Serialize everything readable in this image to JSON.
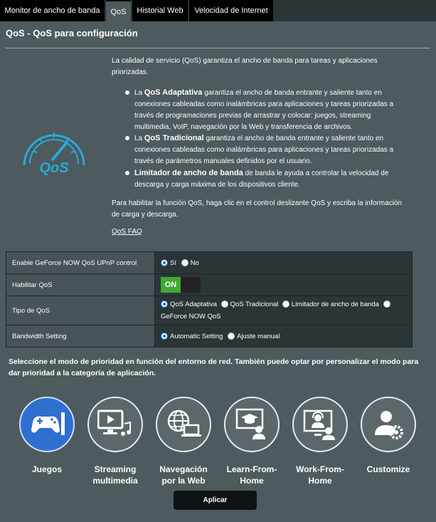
{
  "tabs": [
    {
      "label": "Monitor de ancho de banda"
    },
    {
      "label": "QoS"
    },
    {
      "label": "Historial Web"
    },
    {
      "label": "Velocidad de Internet"
    }
  ],
  "page_title": "QoS - QoS para configuración",
  "intro": "La calidad de servicio (QoS) garantiza el ancho de banda para tareas y aplicaciones priorizadas.",
  "bullets": [
    {
      "bold": "QoS Adaptativa",
      "pre": "La ",
      "lines": [
        "garantiza el ancho de banda entrante y saliente tanto en",
        "conexiones cableadas como inalámbricas para aplicaciones y tareas priorizadas a",
        "través de programaciones previas de arrastrar y colocar: juegos, streaming",
        "multimedia, VoIP, navegación por la Web y transferencia de archivos."
      ]
    },
    {
      "bold": "QoS Tradicional",
      "pre": "La ",
      "lines": [
        "garantiza el ancho de banda entrante y saliente tanto en",
        "conexiones cableadas como inalámbricas para aplicaciones y tareas priorizadas a",
        "través de parámetros manuales definidos por el usuario."
      ]
    },
    {
      "bold": "Limitador de ancho de banda",
      "pre": "",
      "lines": [
        "de banda le ayuda a controlar la velocidad de",
        "descarga y carga máxima de los dispositivos cliente."
      ]
    }
  ],
  "enable_hint_lines": [
    "Para habilitar la función QoS, haga clic en el control deslizante QoS y escriba la información",
    "de carga y descarga."
  ],
  "faq_label": "QoS FAQ",
  "logo_text": "QoS",
  "settings": {
    "geforce": {
      "label": "Enable GeForce NOW QoS UPnP control",
      "options": [
        "Sí",
        "No"
      ],
      "selected": "Sí"
    },
    "enable_qos": {
      "label": "Habilitar QoS",
      "toggle_text": "ON"
    },
    "qos_type": {
      "label": "Tipo de QoS",
      "options": [
        "QoS Adaptativa",
        "QoS Tradicional",
        "Limitador de ancho de banda",
        "GeForce NOW QoS"
      ],
      "selected": "QoS Adaptativa"
    },
    "bandwidth": {
      "label": "Bandwidth Setting",
      "options": [
        "Automatic Setting",
        "Ajuste manual"
      ],
      "selected": "Automatic Setting"
    }
  },
  "priority_text": "Seleccione el modo de prioridad en función del entorno de red. También puede optar por personalizar el modo para dar prioridad a la categoría de aplicación.",
  "modes": [
    {
      "label1": "Juegos",
      "label2": "",
      "icon": "gamepad-icon",
      "selected": true
    },
    {
      "label1": "Streaming",
      "label2": "multimedia",
      "icon": "media-streaming-icon",
      "selected": false
    },
    {
      "label1": "Navegación",
      "label2": "por la Web",
      "icon": "web-browsing-icon",
      "selected": false
    },
    {
      "label1": "Learn-From-",
      "label2": "Home",
      "icon": "learn-from-home-icon",
      "selected": false
    },
    {
      "label1": "Work-From-",
      "label2": "Home",
      "icon": "work-from-home-icon",
      "selected": false
    },
    {
      "label1": "Customize",
      "label2": "",
      "icon": "customize-icon",
      "selected": false
    }
  ],
  "apply_label": "Aplicar",
  "colors": {
    "accent": "#2f6fcf",
    "toggle_on": "#40a935",
    "panel": "#4d5a5e",
    "logo": "#29a9d8"
  }
}
